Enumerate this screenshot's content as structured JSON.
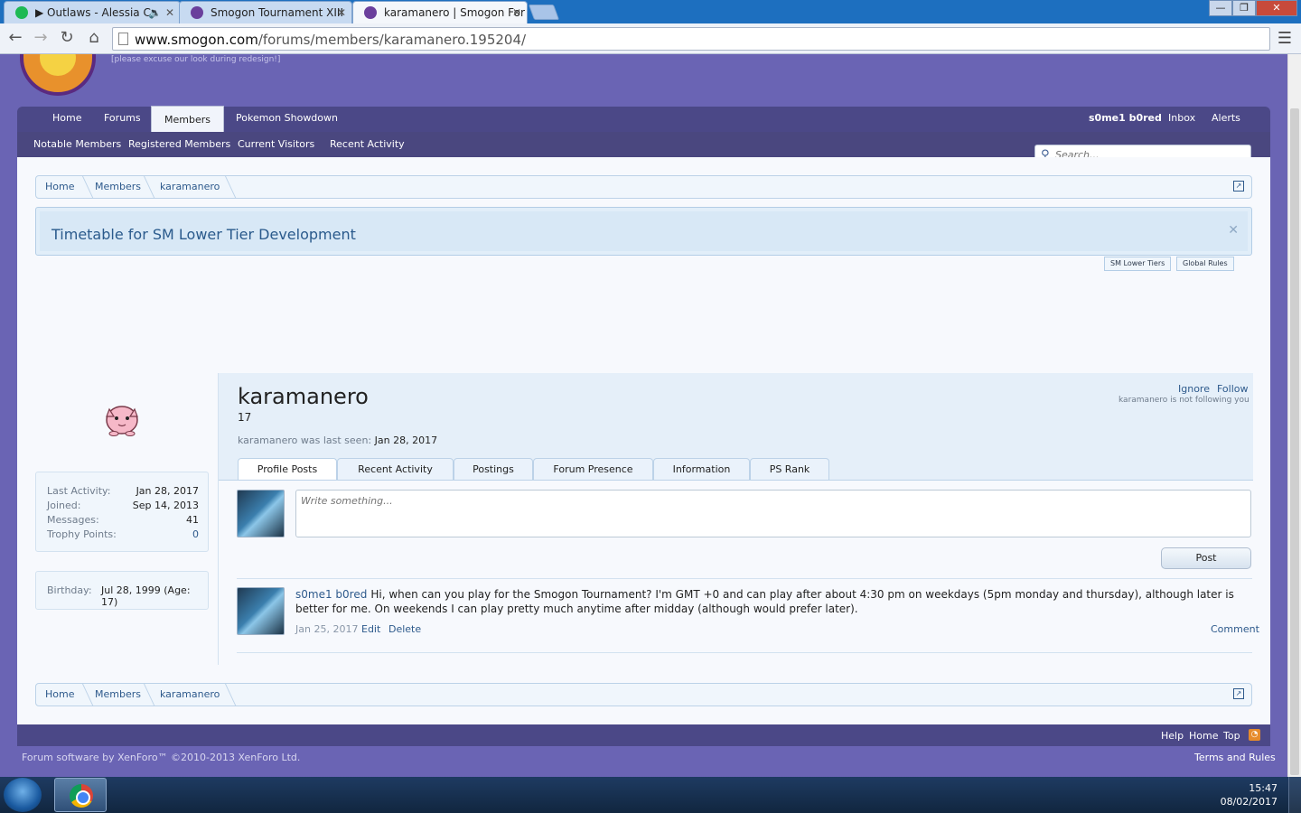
{
  "browser": {
    "tabs": [
      {
        "title": "▶ Outlaws - Alessia Ca",
        "icon": "spotify-icon",
        "icon_color": "#1db954"
      },
      {
        "title": "Smogon Tournament XIII",
        "icon": "smogon-icon",
        "icon_color": "#6a3f9c"
      },
      {
        "title": "karamanero | Smogon For",
        "icon": "smogon-icon",
        "icon_color": "#6a3f9c"
      }
    ],
    "url_host": "www.smogon.com",
    "url_path": "/forums/members/karamanero.195204/"
  },
  "site": {
    "tagline": "[please excuse our look during redesign!]",
    "nav": {
      "home": "Home",
      "forums": "Forums",
      "members": "Members",
      "showdown": "Pokemon Showdown",
      "user": "s0me1 b0red",
      "inbox": "Inbox",
      "alerts": "Alerts"
    },
    "subnav": {
      "notable": "Notable Members",
      "registered": "Registered Members",
      "visitors": "Current Visitors",
      "activity": "Recent Activity"
    },
    "search_placeholder": "Search..."
  },
  "breadcrumbs": [
    "Home",
    "Members",
    "karamanero"
  ],
  "notice": {
    "title": "Timetable for SM Lower Tier Development",
    "tabs": [
      "SM Lower Tiers",
      "Global Rules"
    ]
  },
  "sidebar": {
    "stats": [
      {
        "label": "Last Activity:",
        "value": "Jan 28, 2017"
      },
      {
        "label": "Joined:",
        "value": "Sep 14, 2013"
      },
      {
        "label": "Messages:",
        "value": "41"
      },
      {
        "label": "Trophy Points:",
        "value": "0"
      }
    ],
    "birthday_label": "Birthday:",
    "birthday_value": "Jul 28, 1999 (Age: 17)"
  },
  "profile": {
    "username": "karamanero",
    "user_title": "17",
    "last_seen_label": "karamanero was last seen:",
    "last_seen_value": "Jan 28, 2017",
    "ignore": "Ignore",
    "follow": "Follow",
    "not_following": "karamanero is not following you",
    "tabs": [
      "Profile Posts",
      "Recent Activity",
      "Postings",
      "Forum Presence",
      "Information",
      "PS Rank"
    ],
    "write_placeholder": "Write something...",
    "post_button": "Post",
    "message": {
      "author": "s0me1 b0red",
      "text": "Hi, when can you play for the Smogon Tournament? I'm GMT +0 and can play after about 4:30 pm on weekdays (5pm monday and thursday), although later is better for me. On weekends I can play pretty much anytime after midday (although would prefer later).",
      "date": "Jan 25, 2017",
      "edit": "Edit",
      "delete": "Delete",
      "comment": "Comment"
    }
  },
  "footer": {
    "help": "Help",
    "home": "Home",
    "top": "Top",
    "copyright": "Forum software by XenForo™ ©2010-2013 XenForo Ltd.",
    "terms": "Terms and Rules"
  },
  "taskbar": {
    "time": "15:47",
    "date": "08/02/2017"
  }
}
